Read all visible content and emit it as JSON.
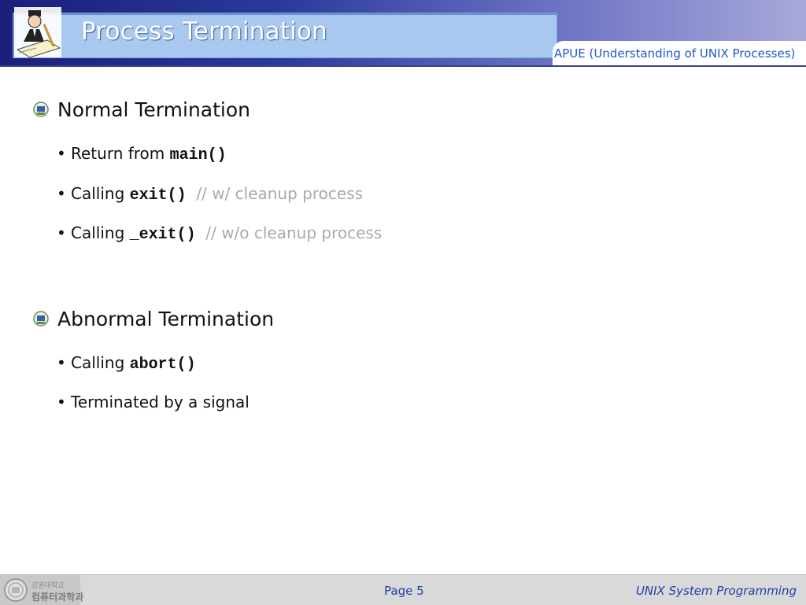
{
  "header": {
    "title": "Process Termination",
    "subtitle": "APUE (Understanding of UNIX Processes)"
  },
  "sections": [
    {
      "title": "Normal Termination",
      "bullets": [
        {
          "text": "Return from ",
          "code": "main()",
          "comment": ""
        },
        {
          "text": "Calling ",
          "code": "exit()",
          "comment": "// w/ cleanup process"
        },
        {
          "text": "Calling ",
          "code": "_exit()",
          "comment": "// w/o cleanup process"
        }
      ]
    },
    {
      "title": "Abnormal Termination",
      "bullets": [
        {
          "text": "Calling ",
          "code": "abort()",
          "comment": ""
        },
        {
          "text": "Terminated by a signal",
          "code": "",
          "comment": ""
        }
      ]
    }
  ],
  "footer": {
    "org_line1": "강원대학교",
    "org_line2": "컴퓨터과학과",
    "page": "Page 5",
    "course": "UNIX System Programming"
  },
  "colors": {
    "header_dark": "#1a1f7a",
    "title_box": "#a9c8ef",
    "subtitle": "#1f59c8",
    "comment": "#a9a9a9",
    "footer_text": "#1f3fa8"
  },
  "icons": {
    "logo": "presenter-at-desk-icon",
    "section": "university-emblem-bullet-icon",
    "footer": "university-seal-icon"
  }
}
